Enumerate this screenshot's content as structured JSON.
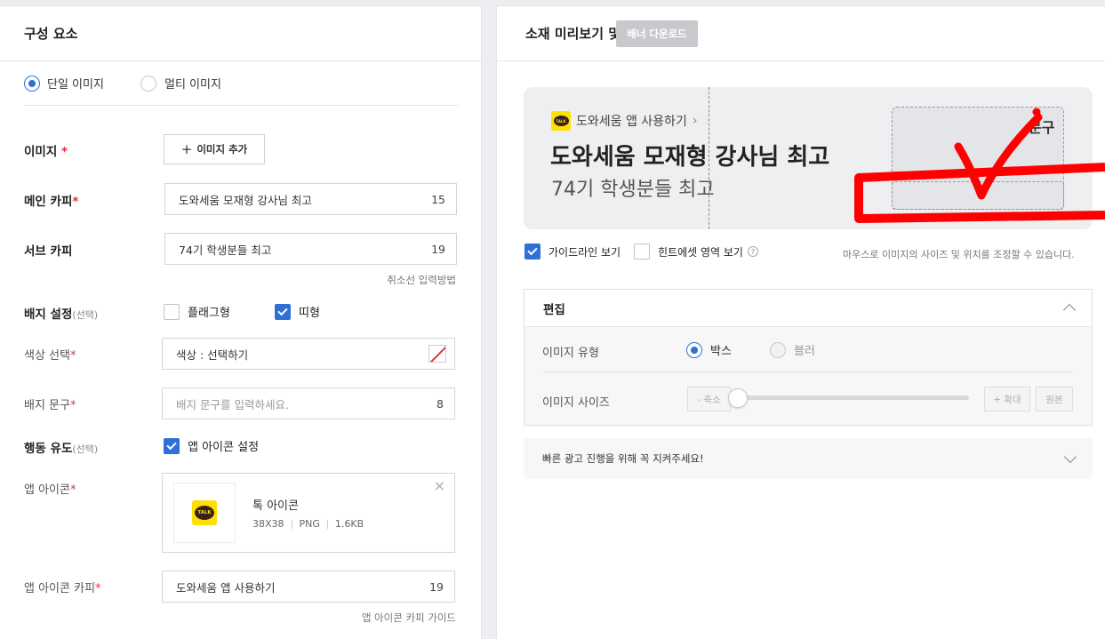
{
  "left": {
    "title": "구성 요소",
    "type_options": [
      "단일 이미지",
      "멀티 이미지"
    ],
    "image": {
      "label": "이미지",
      "req": "*",
      "add_btn": "이미지 추가"
    },
    "main_copy": {
      "label": "메인 카피",
      "req": "*",
      "value": "도와세움 모재형 강사님 최고",
      "count": "15"
    },
    "sub_copy": {
      "label": "서브 카피",
      "value": "74기 학생분들 최고",
      "count": "19",
      "hint": "취소선 입력방법"
    },
    "badge": {
      "label": "배지 설정",
      "opt": "(선택)",
      "flag": "플래그형",
      "band": "띠형"
    },
    "color": {
      "label": "색상 선택",
      "req": "*",
      "value": "색상 : 선택하기"
    },
    "badge_text": {
      "label": "배지 문구",
      "req": "*",
      "placeholder": "배지 문구를 입력하세요.",
      "count": "8"
    },
    "cta": {
      "label": "행동 유도",
      "opt": "(선택)",
      "check": "앱 아이콘 설정"
    },
    "app_icon": {
      "label": "앱 아이콘",
      "req": "*",
      "name": "톡 아이콘",
      "size": "38X38",
      "format": "PNG",
      "filesize": "1.6KB",
      "talk": "TALK",
      "close": "×"
    },
    "app_icon_copy": {
      "label": "앱 아이콘 카피",
      "req": "*",
      "value": "도와세움 앱 사용하기",
      "count": "19",
      "hint": "앱 아이콘 카피 가이드"
    }
  },
  "right": {
    "title": "소재 미리보기 및 편집",
    "download": "배너 다운로드",
    "preview": {
      "app": "도와세움 앱 사용하기",
      "arrow": "›",
      "main": "도와세움 모재형 강사님 최고",
      "sub": "74기 학생분들 최고",
      "badge": "문구",
      "talk": "TALK"
    },
    "guide_check": "가이드라인 보기",
    "hint_check": "힌트에셋 영역 보기",
    "help_q": "?",
    "mouse_hint": "마우스로 이미지의 사이즈 및 위치를 조정할 수 있습니다.",
    "edit": {
      "title": "편집",
      "type_label": "이미지 유형",
      "type_options": [
        "박스",
        "블러"
      ],
      "size_label": "이미지 사이즈",
      "shrink": "- 축소",
      "enlarge": "+ 확대",
      "original": "원본",
      "size_level": 0
    },
    "tip": "빠른 광고 진행을 위해 꼭 지켜주세요!"
  },
  "colors": {
    "accent": "#2f6fd6",
    "required": "#e0323c",
    "annotation": "#ff0000",
    "kakao_yellow": "#fae100"
  }
}
